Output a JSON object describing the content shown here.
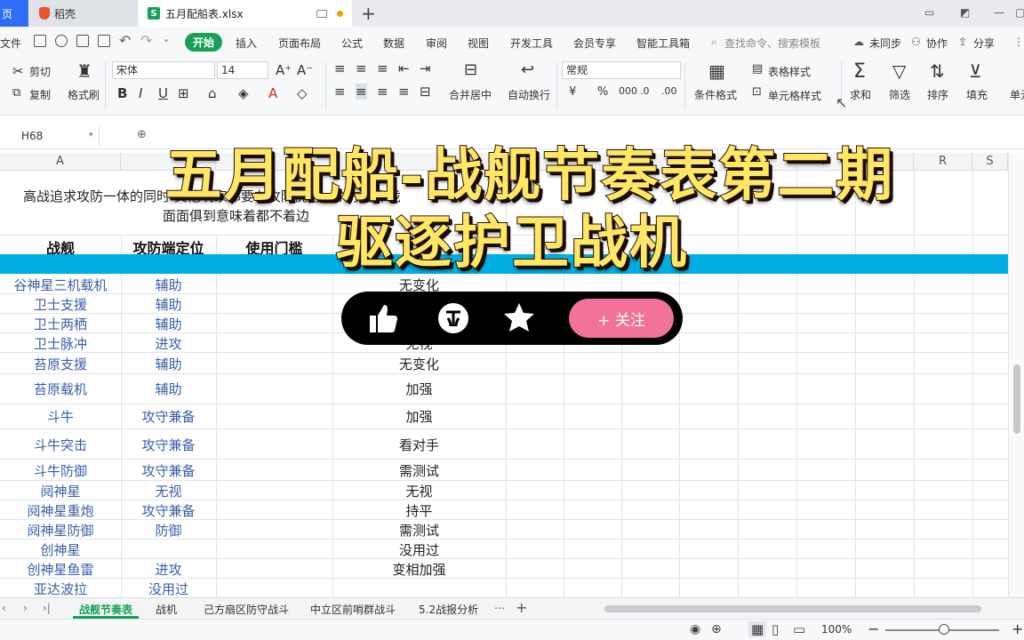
{
  "tabs": {
    "home_label": "页",
    "daoke_label": "稻壳",
    "file_label": "五月配船表.xlsx",
    "new_tab": "+"
  },
  "menu": {
    "file": "文件",
    "start": "开始",
    "items": [
      "插入",
      "页面布局",
      "公式",
      "数据",
      "审阅",
      "视图",
      "开发工具",
      "会员专享",
      "智能工具箱"
    ],
    "search_placeholder": "查找命令、搜索模板",
    "sync": "未同步",
    "collab": "协作",
    "share": "分享"
  },
  "ribbon": {
    "cut": "剪切",
    "copy": "复制",
    "format_painter": "格式刷",
    "font_name": "宋体",
    "font_size": "14",
    "merge_center": "合并居中",
    "wrap_text": "自动换行",
    "number_format": "常规",
    "conditional_format": "条件格式",
    "table_style": "表格样式",
    "cell_style": "单元格样式",
    "sum": "求和",
    "filter": "筛选",
    "sort": "排序",
    "fill": "填充",
    "cell": "单元"
  },
  "formula_bar": {
    "name_box": "H68"
  },
  "columns": {
    "A": "A",
    "P": "P",
    "R": "R",
    "S": "S"
  },
  "notes": {
    "line1": "高战追求攻防一体的同时 其他玩家都要在攻防挑选一个方向靠拢",
    "line2": "面面俱到意味着都不着边"
  },
  "table": {
    "headers": [
      "战舰",
      "攻防端定位",
      "使用门槛"
    ],
    "rows": [
      {
        "name": "谷神星三机载机",
        "role": "辅助",
        "change": "无变化"
      },
      {
        "name": "卫士支援",
        "role": "辅助",
        "change": ""
      },
      {
        "name": "卫士两栖",
        "role": "辅助",
        "change": ""
      },
      {
        "name": "卫士脉冲",
        "role": "进攻",
        "change": "无视"
      },
      {
        "name": "苔原支援",
        "role": "辅助",
        "change": "无变化"
      },
      {
        "name": "苔原载机",
        "role": "辅助",
        "change": "加强"
      },
      {
        "name": "斗牛",
        "role": "攻守兼备",
        "change": "加强"
      },
      {
        "name": "斗牛突击",
        "role": "攻守兼备",
        "change": "看对手"
      },
      {
        "name": "斗牛防御",
        "role": "攻守兼备",
        "change": "需测试"
      },
      {
        "name": "阋神星",
        "role": "无视",
        "change": "无视"
      },
      {
        "name": "阋神星重炮",
        "role": "攻守兼备",
        "change": "持平"
      },
      {
        "name": "阋神星防御",
        "role": "防御",
        "change": "需测试"
      },
      {
        "name": "创神星",
        "role": "",
        "change": "没用过"
      },
      {
        "name": "创神星鱼雷",
        "role": "进攻",
        "change": "变相加强"
      },
      {
        "name": "亚达波拉",
        "role": "没用过",
        "change": ""
      }
    ]
  },
  "sheets": [
    "战舰节奏表",
    "战机",
    "己方扇区防守战斗",
    "中立区前哨群战斗",
    "5.2战报分析"
  ],
  "status": {
    "zoom": "100%"
  },
  "overlay": {
    "title_line1": "五月配船-战舰节奏表第二期",
    "title_line2": "驱逐护卫战机",
    "follow": "+ 关注"
  },
  "colors": {
    "accent_green": "#18a058",
    "band_blue": "#00aee6",
    "follow_pink": "#f1739a",
    "title_yellow": "#ffe766"
  }
}
